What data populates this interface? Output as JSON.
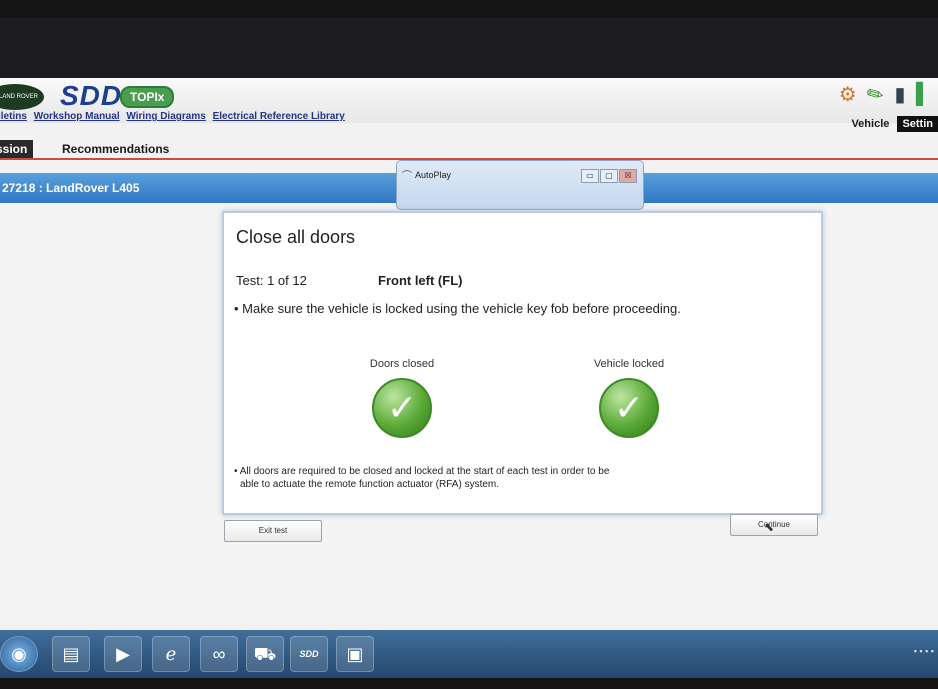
{
  "header": {
    "brand": "LAND ROVER",
    "app_logo": "SDD",
    "topix_logo": "TOPIx",
    "nav_links": [
      "lletins",
      "Workshop Manual",
      "Wiring Diagrams",
      "Electrical Reference Library"
    ],
    "right_icons": [
      "gears-icon",
      "pen-icon",
      "database-icon",
      "leaf-icon"
    ],
    "right_tabs": [
      "Vehicle",
      "Settin"
    ]
  },
  "session_tabs": [
    "ssion",
    "Recommendations"
  ],
  "vehicle_bar": "27218 : LandRover L405",
  "autoplay": {
    "title": "AutoPlay",
    "buttons": [
      "▭",
      "▢",
      "☒"
    ]
  },
  "dialog": {
    "title": "Close all doors",
    "test_info": "Test: 1 of 12",
    "test_label": "Front left (FL)",
    "instruction": "• Make sure the vehicle is locked using the vehicle key fob before proceeding.",
    "statuses": [
      {
        "label": "Doors closed",
        "icon": "check-icon"
      },
      {
        "label": "Vehicle locked",
        "icon": "check-icon"
      }
    ],
    "note_line1": "• All doors are required to be closed and locked at the start of each test in order to be",
    "note_line2": "able to actuate the remote function actuator (RFA) system."
  },
  "buttons": {
    "exit": "Exit test",
    "continue": "Continue"
  },
  "taskbar": {
    "items": [
      "start-orb",
      "explorer-icon",
      "media-icon",
      "ie-icon",
      "sdd-link-icon",
      "car-icon",
      "SDD",
      "printer-icon"
    ],
    "sdd_label": "SDD"
  }
}
